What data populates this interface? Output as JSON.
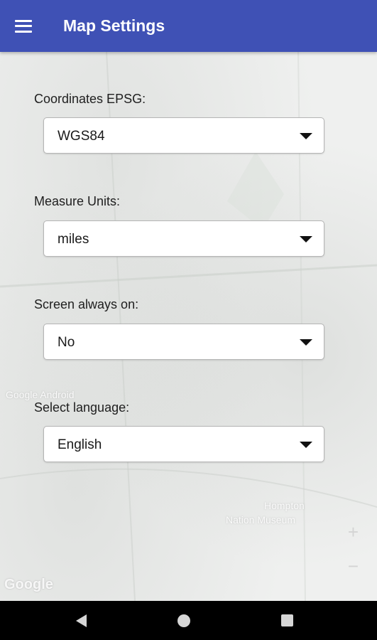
{
  "app_bar": {
    "title": "Map Settings",
    "menu_icon": "hamburger-menu-icon",
    "background": "#3f51b5"
  },
  "settings": [
    {
      "id": "coordinates",
      "label": "Coordinates EPSG:",
      "value": "WGS84"
    },
    {
      "id": "measure-units",
      "label": "Measure Units:",
      "value": "miles"
    },
    {
      "id": "screen-on",
      "label": "Screen always on:",
      "value": "No"
    },
    {
      "id": "language",
      "label": "Select language:",
      "value": "English"
    }
  ],
  "map_background": {
    "watermark": "Google",
    "labels": [
      "Google Android",
      "Hompton",
      "Nation Museum"
    ]
  },
  "nav_bar": {
    "icons": [
      "back-icon",
      "home-icon",
      "recent-apps-icon"
    ]
  }
}
